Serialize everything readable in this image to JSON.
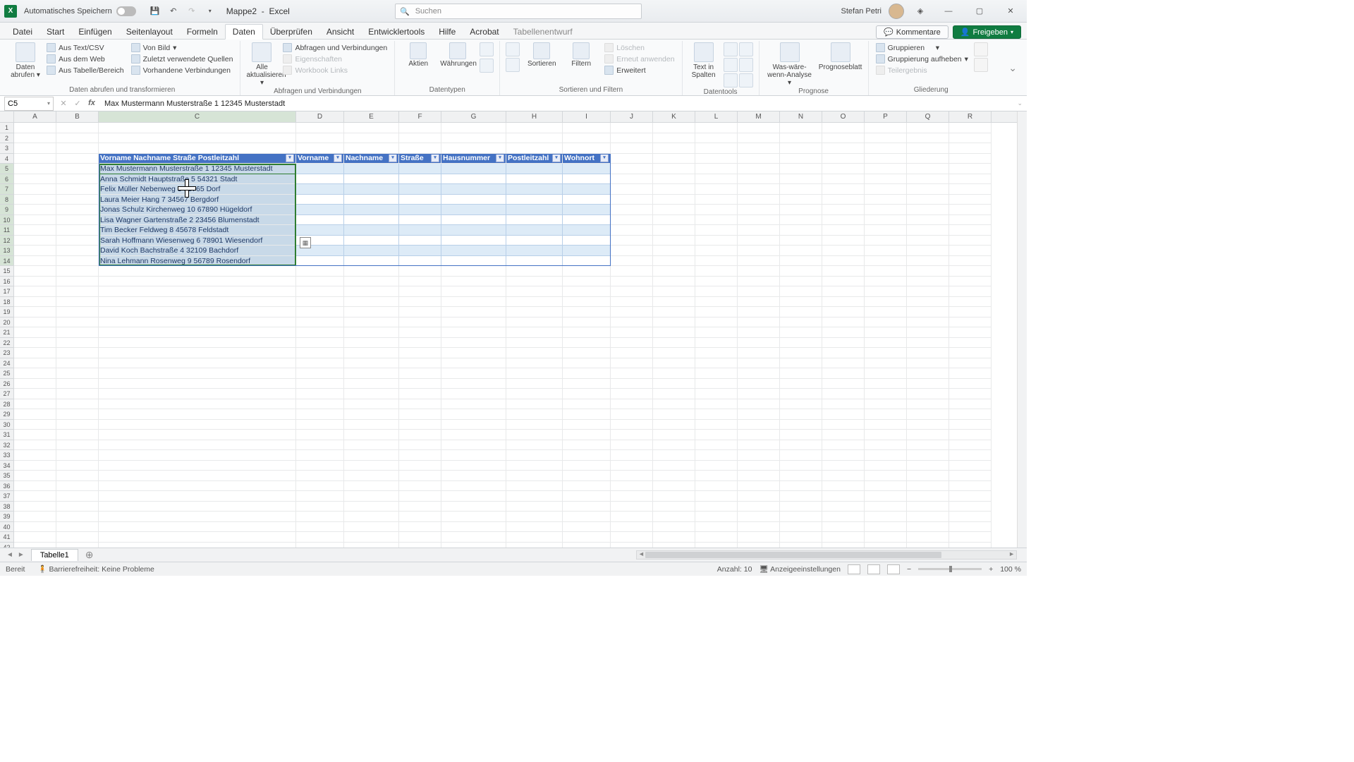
{
  "title": {
    "autosave": "Automatisches Speichern",
    "doc": "Mappe2",
    "app": "Excel",
    "search_ph": "Suchen",
    "user": "Stefan Petri"
  },
  "menutabs": [
    "Datei",
    "Start",
    "Einfügen",
    "Seitenlayout",
    "Formeln",
    "Daten",
    "Überprüfen",
    "Ansicht",
    "Entwicklertools",
    "Hilfe",
    "Acrobat",
    "Tabellenentwurf"
  ],
  "active_tab": "Daten",
  "menubtns": {
    "comments": "Kommentare",
    "share": "Freigeben"
  },
  "ribbon": {
    "g1": {
      "big": "Daten abrufen",
      "items": [
        "Aus Text/CSV",
        "Aus dem Web",
        "Aus Tabelle/Bereich",
        "Von Bild",
        "Zuletzt verwendete Quellen",
        "Vorhandene Verbindungen"
      ],
      "label": "Daten abrufen und transformieren"
    },
    "g2": {
      "big": "Alle aktualisieren",
      "items": [
        "Abfragen und Verbindungen",
        "Eigenschaften",
        "Workbook Links"
      ],
      "label": "Abfragen und Verbindungen"
    },
    "g3": {
      "btns": [
        "Aktien",
        "Währungen"
      ],
      "label": "Datentypen"
    },
    "g4": {
      "btns": [
        "Sortieren",
        "Filtern"
      ],
      "items": [
        "Löschen",
        "Erneut anwenden",
        "Erweitert"
      ],
      "label": "Sortieren und Filtern"
    },
    "g5": {
      "big": "Text in Spalten",
      "label": "Datentools"
    },
    "g6": {
      "btns": [
        "Was-wäre-wenn-Analyse",
        "Prognoseblatt"
      ],
      "label": "Prognose"
    },
    "g7": {
      "items": [
        "Gruppieren",
        "Gruppierung aufheben",
        "Teilergebnis"
      ],
      "label": "Gliederung"
    }
  },
  "namebox": "C5",
  "formula": "Max Mustermann Musterstraße 1 12345 Musterstadt",
  "cols": [
    "A",
    "B",
    "C",
    "D",
    "E",
    "F",
    "G",
    "H",
    "I",
    "J",
    "K",
    "L",
    "M",
    "N",
    "O",
    "P",
    "Q",
    "R"
  ],
  "table": {
    "header1": "Vorname Nachname Straße Postleitzahl",
    "headers2": [
      "Vorname",
      "Nachname",
      "Straße",
      "Hausnummer",
      "Postleitzahl",
      "Wohnort"
    ],
    "rows": [
      "Max Mustermann Musterstraße 1 12345 Musterstadt",
      "Anna Schmidt Hauptstraße 5 54321 Stadt",
      "Felix Müller Nebenweg 3 98765 Dorf",
      "Laura Meier Hang 7 34567 Bergdorf",
      "Jonas Schulz Kirchenweg 10 67890 Hügeldorf",
      "Lisa Wagner Gartenstraße 2 23456 Blumenstadt",
      "Tim Becker Feldweg 8 45678 Feldstadt",
      "Sarah Hoffmann Wiesenweg 6 78901 Wiesendorf",
      "David Koch Bachstraße 4 32109 Bachdorf",
      "Nina Lehmann Rosenweg 9 56789 Rosendorf"
    ]
  },
  "sheettab": "Tabelle1",
  "status": {
    "ready": "Bereit",
    "access": "Barrierefreiheit: Keine Probleme",
    "count_lbl": "Anzahl:",
    "count": "10",
    "display": "Anzeigeeinstellungen",
    "zoom": "100 %"
  }
}
